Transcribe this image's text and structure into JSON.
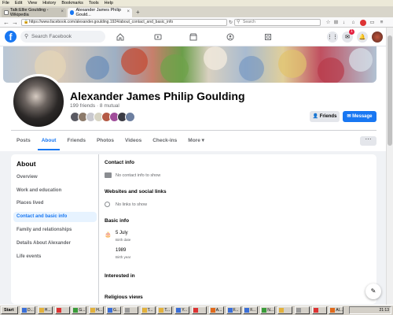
{
  "browser": {
    "menu": [
      "File",
      "Edit",
      "View",
      "History",
      "Bookmarks",
      "Tools",
      "Help"
    ],
    "tabs": [
      {
        "label": "Talk:Ellie Goulding - Wikipedia"
      },
      {
        "label": "Alexander James Philip Gould..."
      }
    ],
    "url": "https://www.facebook.com/alexander.goulding.1924/about_contact_and_basic_info",
    "search_placeholder": "Search"
  },
  "fb": {
    "logo": "f",
    "search_placeholder": "Search Facebook",
    "notification_count": "1"
  },
  "profile": {
    "name": "Alexander James Philip Goulding",
    "friends_line": "199 friends · 8 mutual",
    "friends_button": "Friends",
    "message_button": "Message",
    "tabs": [
      "Posts",
      "About",
      "Friends",
      "Photos",
      "Videos",
      "Check-ins",
      "More ▾"
    ],
    "more_dots": "···"
  },
  "about": {
    "title": "About",
    "nav": [
      "Overview",
      "Work and education",
      "Places lived",
      "Contact and basic info",
      "Family and relationships",
      "Details About Alexander",
      "Life events"
    ],
    "contact_head": "Contact info",
    "contact_empty": "No contact info to show",
    "websites_head": "Websites and social links",
    "websites_empty": "No links to show",
    "basic_head": "Basic info",
    "birth_date": "5 July",
    "birth_date_label": "Birth date",
    "birth_year": "1989",
    "birth_year_label": "Birth year",
    "interested_head": "Interested in",
    "religious_head": "Religious views"
  },
  "taskbar": {
    "start": "Start",
    "items": [
      "D...",
      "H...",
      "",
      "G...",
      "H...",
      "G...",
      "",
      "T...",
      "T...",
      "Y...",
      "",
      "A...",
      "F...",
      "F...",
      "N...",
      "",
      "",
      "",
      "Al..."
    ],
    "time": "21:13"
  },
  "colors": {
    "fb_blue": "#1877f2",
    "active_nav_bg": "#e7f3ff"
  }
}
